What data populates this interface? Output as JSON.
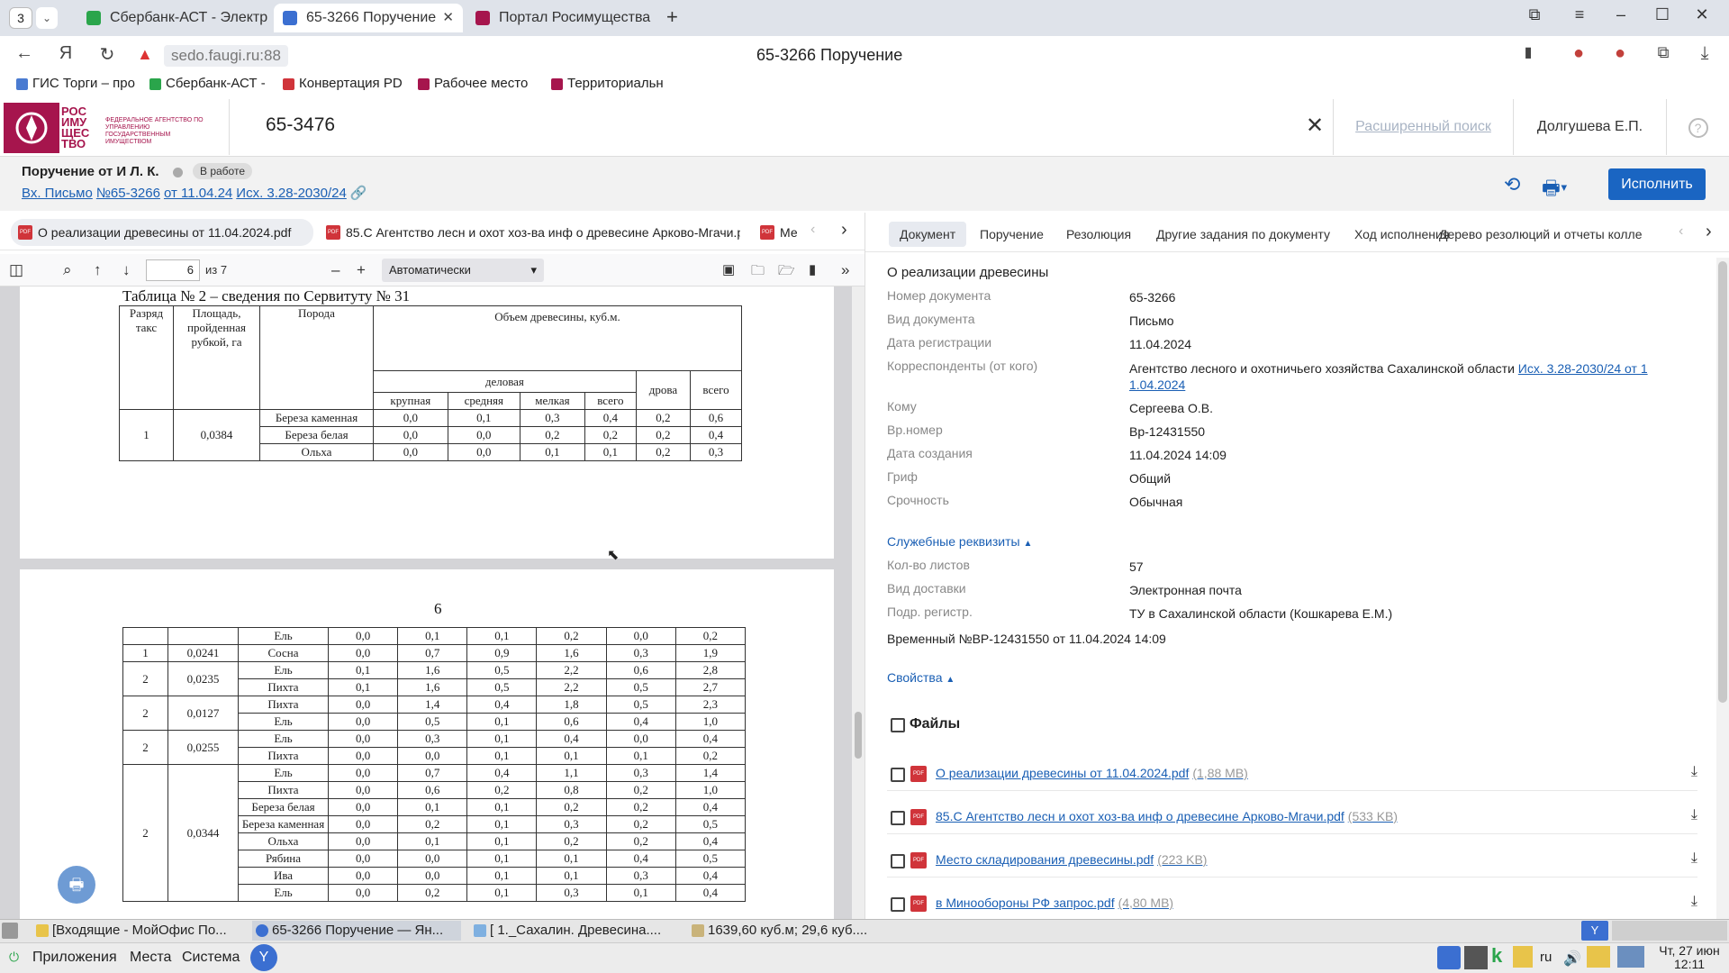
{
  "browser": {
    "tab_count": "3",
    "tabs": [
      {
        "label": "Сбербанк-АСТ - Электр"
      },
      {
        "label": "65-3266 Поручение"
      },
      {
        "label": "Портал Росимущества"
      }
    ],
    "url": "sedo.faugi.ru:88",
    "page_title": "65-3266 Поручение",
    "bookmarks": [
      {
        "label": "ГИС Торги – про"
      },
      {
        "label": "Сбербанк-АСТ -"
      },
      {
        "label": "Конвертация PD"
      },
      {
        "label": "Рабочее место"
      },
      {
        "label": "Территориальн"
      }
    ]
  },
  "app": {
    "logo_text": "РОС ИМУ ЩЕС ТВО",
    "logo_subtext": "ФЕДЕРАЛЬНОЕ АГЕНТСТВО ПО УПРАВЛЕНИЮ ГОСУДАРСТВЕННЫМ ИМУЩЕСТВОМ",
    "search_value": "65-3476",
    "advanced_search": "Расширенный поиск",
    "user": "Долгушева Е.П.",
    "help": "?"
  },
  "order": {
    "title": "Поручение от И Л. К.",
    "status": "В работе",
    "links": [
      "Вх. Письмо",
      "№65-3266",
      "от 11.04.24",
      "Исх. 3.28-2030/24"
    ],
    "execute_label": "Исполнить"
  },
  "file_tabs": [
    "О реализации древесины от 11.04.2024.pdf",
    "85.С Агентство лесн и охот хоз-ва инф о древесине Арково-Мгачи.pdf",
    "Ме"
  ],
  "pdf_toolbar": {
    "page": "6",
    "of": "из 7",
    "zoom": "Автоматически"
  },
  "pdf": {
    "table2_title": "Таблица № 2 – сведения по Сервитуту № 31",
    "t1_headers": {
      "razryad": "Разряд такс",
      "area": "Площадь, пройденная рубкой, га",
      "poroda": "Порода",
      "volume": "Объем древесины, куб.м.",
      "delovaya": "деловая",
      "krupnaya": "крупная",
      "srednyaya": "средняя",
      "melkaya": "мелкая",
      "vsego": "всего",
      "drova": "дрова",
      "vsego2": "всего"
    },
    "t1_group": {
      "razryad": "1",
      "area": "0,0384"
    },
    "t1_rows": [
      [
        "Береза каменная",
        "0,0",
        "0,1",
        "0,3",
        "0,4",
        "0,2",
        "0,6"
      ],
      [
        "Береза белая",
        "0,0",
        "0,0",
        "0,2",
        "0,2",
        "0,2",
        "0,4"
      ],
      [
        "Ольха",
        "0,0",
        "0,0",
        "0,1",
        "0,1",
        "0,2",
        "0,3"
      ]
    ],
    "page_num": "6",
    "t2_rows": [
      [
        "",
        "",
        "Ель",
        "0,0",
        "0,1",
        "0,1",
        "0,2",
        "0,0",
        "0,2"
      ],
      [
        "1",
        "0,0241",
        "Сосна",
        "0,0",
        "0,7",
        "0,9",
        "1,6",
        "0,3",
        "1,9"
      ],
      [
        "2",
        "0,0235",
        "Ель",
        "0,1",
        "1,6",
        "0,5",
        "2,2",
        "0,6",
        "2,8"
      ],
      [
        "",
        "",
        "Пихта",
        "0,1",
        "1,6",
        "0,5",
        "2,2",
        "0,5",
        "2,7"
      ],
      [
        "2",
        "0,0127",
        "Пихта",
        "0,0",
        "1,4",
        "0,4",
        "1,8",
        "0,5",
        "2,3"
      ],
      [
        "",
        "",
        "Ель",
        "0,0",
        "0,5",
        "0,1",
        "0,6",
        "0,4",
        "1,0"
      ],
      [
        "2",
        "0,0255",
        "Ель",
        "0,0",
        "0,3",
        "0,1",
        "0,4",
        "0,0",
        "0,4"
      ],
      [
        "",
        "",
        "Пихта",
        "0,0",
        "0,0",
        "0,1",
        "0,1",
        "0,1",
        "0,2"
      ],
      [
        "2",
        "0,0344",
        "Ель",
        "0,0",
        "0,7",
        "0,4",
        "1,1",
        "0,3",
        "1,4"
      ],
      [
        "",
        "",
        "Пихта",
        "0,0",
        "0,6",
        "0,2",
        "0,8",
        "0,2",
        "1,0"
      ],
      [
        "",
        "",
        "Береза белая",
        "0,0",
        "0,1",
        "0,1",
        "0,2",
        "0,2",
        "0,4"
      ],
      [
        "",
        "",
        "Береза каменная",
        "0,0",
        "0,2",
        "0,1",
        "0,3",
        "0,2",
        "0,5"
      ],
      [
        "",
        "",
        "Ольха",
        "0,0",
        "0,1",
        "0,1",
        "0,2",
        "0,2",
        "0,4"
      ],
      [
        "",
        "",
        "Рябина",
        "0,0",
        "0,0",
        "0,1",
        "0,1",
        "0,4",
        "0,5"
      ],
      [
        "",
        "",
        "Ива",
        "0,0",
        "0,0",
        "0,1",
        "0,1",
        "0,3",
        "0,4"
      ],
      [
        "",
        "",
        "Ель",
        "0,0",
        "0,2",
        "0,1",
        "0,3",
        "0,1",
        "0,4"
      ]
    ]
  },
  "right_tabs": [
    "Документ",
    "Поручение",
    "Резолюция",
    "Другие задания по документу",
    "Ход исполнения",
    "Дерево резолюций и отчеты колле"
  ],
  "doc": {
    "heading": "О реализации древесины",
    "fields": [
      {
        "label": "Номер документа",
        "value": "65-3266"
      },
      {
        "label": "Вид документа",
        "value": "Письмо"
      },
      {
        "label": "Дата регистрации",
        "value": "11.04.2024"
      },
      {
        "label": "Корреспонденты (от кого)",
        "value": "Агентство лесного и охотничьего хозяйства Сахалинской области",
        "link": "Исх. 3.28-2030/24 от 1",
        "link2": "1.04.2024"
      },
      {
        "label": "Кому",
        "value": "Сергеева О.В."
      },
      {
        "label": "Вр.номер",
        "value": "Вр-12431550"
      },
      {
        "label": "Дата создания",
        "value": "11.04.2024 14:09"
      },
      {
        "label": "Гриф",
        "value": "Общий"
      },
      {
        "label": "Срочность",
        "value": "Обычная"
      }
    ],
    "service_section": "Служебные реквизиты",
    "service_fields": [
      {
        "label": "Кол-во листов",
        "value": "57"
      },
      {
        "label": "Вид доставки",
        "value": "Электронная почта"
      },
      {
        "label": "Подр. регистр.",
        "value": "ТУ в Сахалинской области  (Кошкарева Е.М.)"
      }
    ],
    "temp_number": "Временный  №ВР-12431550 от 11.04.2024 14:09",
    "props_section": "Свойства",
    "files_heading": "Файлы",
    "files": [
      {
        "name": "О реализации древесины от 11.04.2024.pdf",
        "size": "(1,88 MB)"
      },
      {
        "name": "85.С Агентство лесн и охот хоз-ва инф о древесине Арково-Мгачи.pdf",
        "size": "(533 KB)"
      },
      {
        "name": "Место складирования древесины.pdf",
        "size": "(223 KB)"
      },
      {
        "name": "в Минообороны РФ запрос.pdf",
        "size": "(4,80 MB)"
      }
    ]
  },
  "taskbar": {
    "items": [
      "[Входящие - МойОфис По...",
      "65-3266 Поручение — Ян...",
      "[ 1._Сахалин. Древесина....",
      "1639,60 куб.м; 29,6 куб...."
    ],
    "menus": [
      "Приложения",
      "Места",
      "Система"
    ],
    "lang": "ru",
    "date": "Чт, 27 июн",
    "time": "12:11"
  }
}
